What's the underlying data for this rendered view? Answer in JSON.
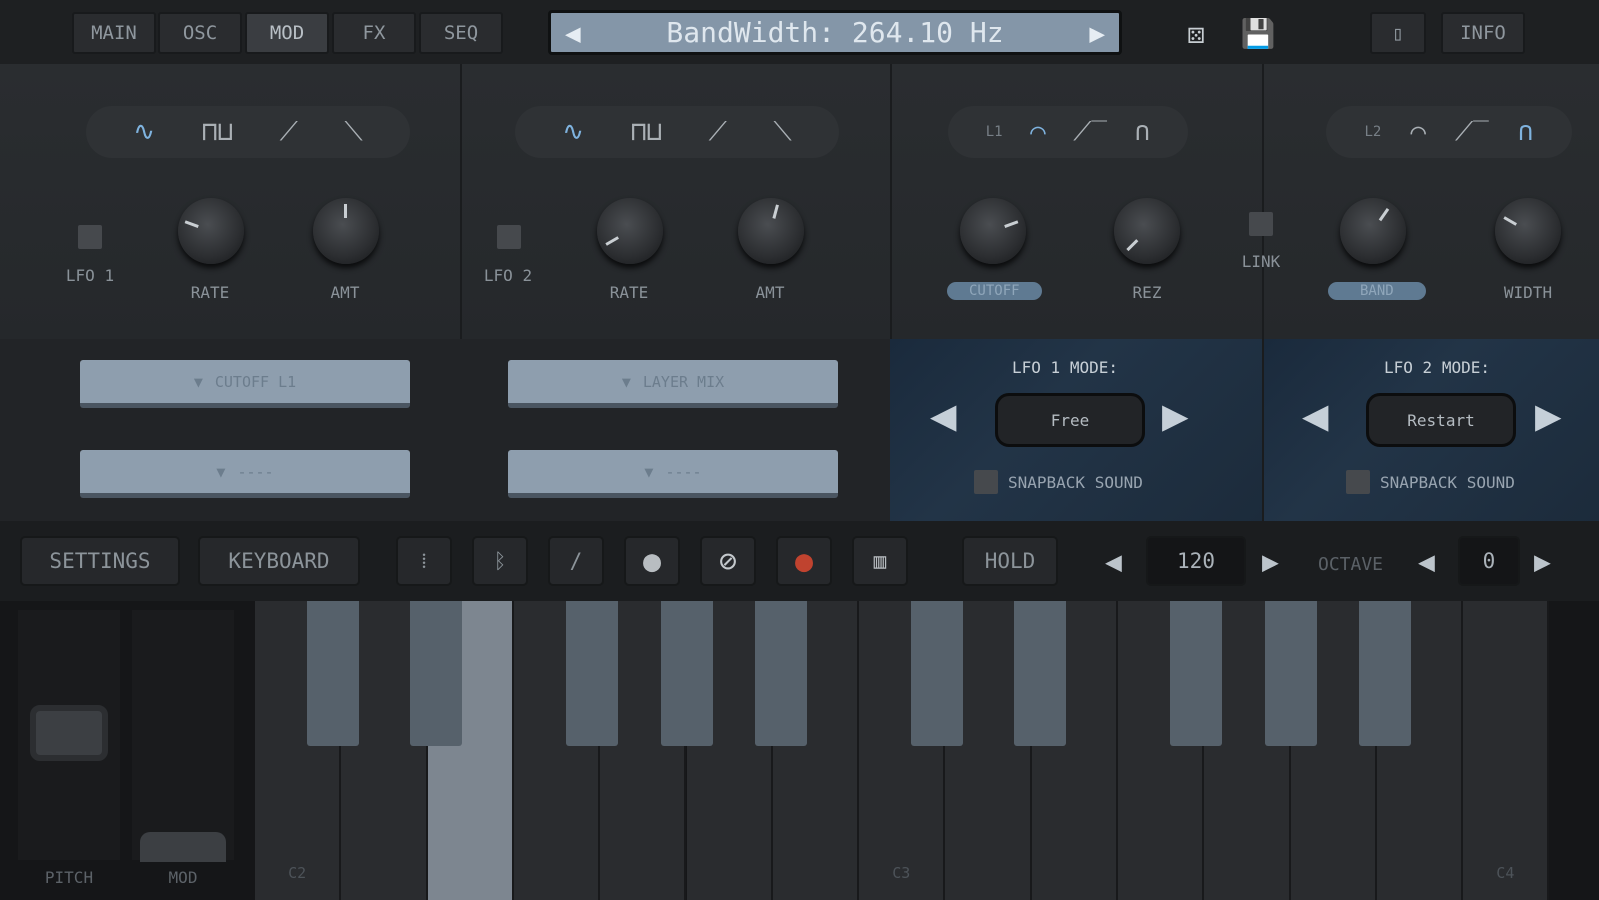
{
  "tabs": [
    {
      "label": "MAIN"
    },
    {
      "label": "OSC"
    },
    {
      "label": "MOD",
      "active": true
    },
    {
      "label": "FX"
    },
    {
      "label": "SEQ"
    }
  ],
  "display": {
    "text": "BandWidth: 264.10 Hz"
  },
  "top_right": {
    "info_label": "INFO"
  },
  "lfo1": {
    "label": "LFO 1",
    "rate": "RATE",
    "amt": "AMT",
    "dest1": "CUTOFF L1",
    "dest2": "----"
  },
  "lfo2": {
    "label": "LFO 2",
    "rate": "RATE",
    "amt": "AMT",
    "dest1": "LAYER MIX",
    "dest2": "----"
  },
  "filter1": {
    "tag": "L1",
    "cutoff": "CUTOFF",
    "rez": "REZ"
  },
  "link": "LINK",
  "filter2": {
    "tag": "L2",
    "band": "BAND",
    "width": "WIDTH"
  },
  "lfo1_mode": {
    "title": "LFO 1 MODE:",
    "value": "Free",
    "snap": "SNAPBACK SOUND"
  },
  "lfo2_mode": {
    "title": "LFO 2 MODE:",
    "value": "Restart",
    "snap": "SNAPBACK SOUND"
  },
  "toolbar": {
    "settings": "SETTINGS",
    "keyboard": "KEYBOARD",
    "hold": "HOLD",
    "tempo": "120",
    "octave_label": "OCTAVE",
    "octave": "0"
  },
  "wheels": {
    "pitch": "PITCH",
    "mod": "MOD"
  },
  "keys": {
    "c2": "C2",
    "c3": "C3",
    "c4": "C4"
  },
  "colors": {
    "accent": "#7fb3df",
    "record": "#c0432f",
    "lcd": "#8496a8"
  }
}
